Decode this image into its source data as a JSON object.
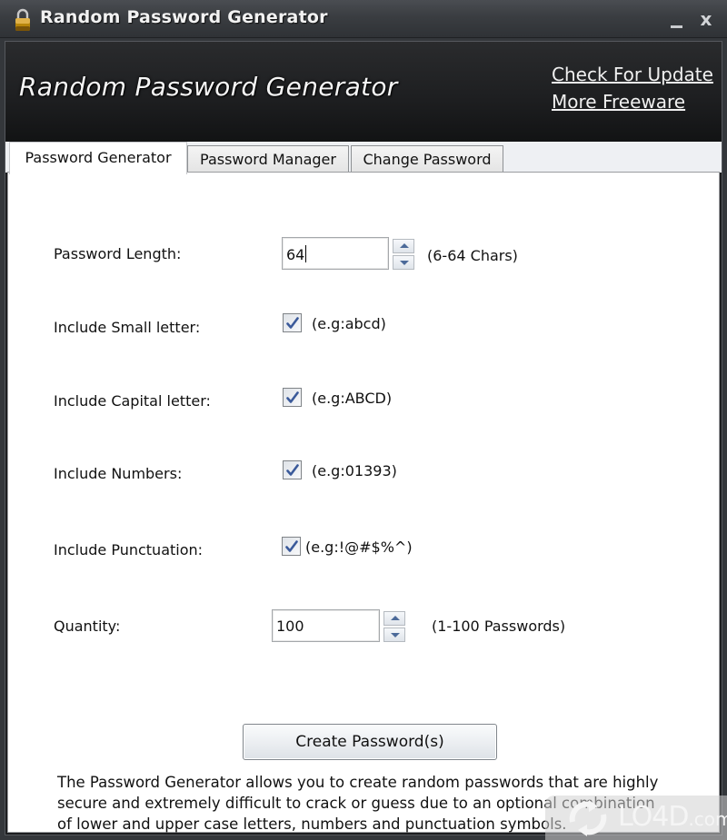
{
  "window": {
    "title": "Random Password Generator",
    "icon": "lock-icon",
    "controls": {
      "minimize": "minimize-icon",
      "close_label": "x"
    }
  },
  "banner": {
    "title": "Random Password Generator",
    "links": [
      {
        "label": "Check For Update"
      },
      {
        "label": "More Freeware"
      }
    ]
  },
  "tabs": [
    {
      "label": "Password Generator",
      "active": true
    },
    {
      "label": "Password Manager",
      "active": false
    },
    {
      "label": "Change Password",
      "active": false
    }
  ],
  "form": {
    "length": {
      "label": "Password Length:",
      "value": "64",
      "hint": "(6-64 Chars)"
    },
    "small": {
      "label": "Include Small letter:",
      "checked": true,
      "hint": "(e.g:abcd)"
    },
    "capital": {
      "label": "Include Capital letter:",
      "checked": true,
      "hint": "(e.g:ABCD)"
    },
    "numbers": {
      "label": "Include Numbers:",
      "checked": true,
      "hint": "(e.g:01393)"
    },
    "punctuation": {
      "label": "Include Punctuation:",
      "checked": true,
      "hint": "(e.g:!@#$%^)"
    },
    "quantity": {
      "label": "Quantity:",
      "value": "100",
      "hint": "(1-100 Passwords)"
    },
    "create_button": "Create Password(s)"
  },
  "description": [
    "The Password Generator allows you to create random passwords that are highly",
    "secure and extremely difficult to crack or guess due to an optional combination",
    "of lower and upper case letters, numbers and punctuation symbols."
  ],
  "watermark": {
    "brand": "LO4D",
    "suffix": ".com"
  },
  "colors": {
    "titlebar": "#3a3d41",
    "banner": "#1e1f21",
    "panel": "#ffffff",
    "checkmark": "#3b5a9a"
  }
}
